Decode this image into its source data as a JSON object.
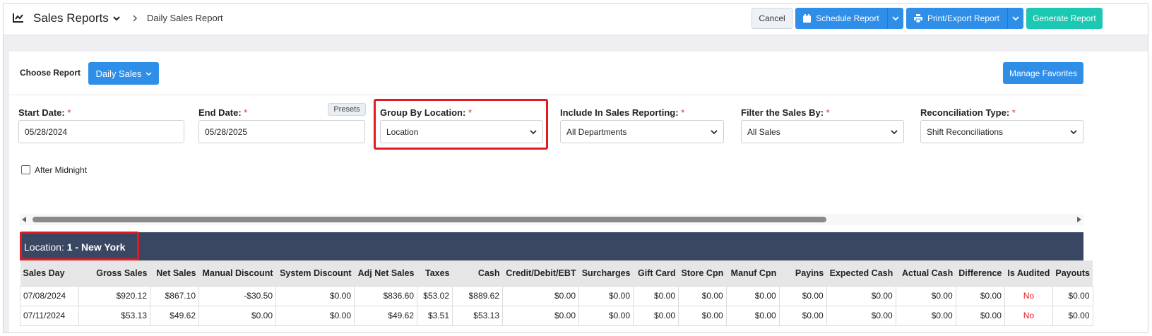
{
  "header": {
    "app_title": "Sales Reports",
    "breadcrumb": "Daily Sales Report",
    "buttons": {
      "cancel": "Cancel",
      "schedule": "Schedule Report",
      "print_export": "Print/Export Report",
      "generate": "Generate Report"
    }
  },
  "report": {
    "choose_label": "Choose Report",
    "selected": "Daily Sales",
    "manage_favorites": "Manage Favorites"
  },
  "filters": {
    "start_date": {
      "label": "Start Date:",
      "value": "05/28/2024"
    },
    "end_date": {
      "label": "End Date:",
      "value": "05/28/2025",
      "presets": "Presets"
    },
    "group_by": {
      "label": "Group By Location:",
      "value": "Location"
    },
    "include": {
      "label": "Include In Sales Reporting:",
      "value": "All Departments"
    },
    "filter_by": {
      "label": "Filter the Sales By:",
      "value": "All Sales"
    },
    "reconciliation": {
      "label": "Reconciliation Type:",
      "value": "Shift Reconciliations"
    },
    "required_mark": "*",
    "after_midnight": "After Midnight"
  },
  "location": {
    "prefix": "Location:",
    "name": "1 - New York"
  },
  "table": {
    "columns": [
      "Sales Day",
      "Gross Sales",
      "Net Sales",
      "Manual Discount",
      "System Discount",
      "Adj Net Sales",
      "Taxes",
      "Cash",
      "Credit/Debit/EBT",
      "Surcharges",
      "Gift Card",
      "Store Cpn",
      "Manuf Cpn",
      "Payins",
      "Expected Cash",
      "Actual Cash",
      "Difference",
      "Is Audited",
      "Payouts"
    ],
    "rows": [
      [
        "07/08/2024",
        "$920.12",
        "$867.10",
        "-$30.50",
        "$0.00",
        "$836.60",
        "$53.02",
        "$889.62",
        "$0.00",
        "$0.00",
        "$0.00",
        "$0.00",
        "$0.00",
        "$0.00",
        "$0.00",
        "$0.00",
        "$0.00",
        "No",
        "$0.00"
      ],
      [
        "07/11/2024",
        "$53.13",
        "$49.62",
        "$0.00",
        "$0.00",
        "$49.62",
        "$3.51",
        "$53.13",
        "$0.00",
        "$0.00",
        "$0.00",
        "$0.00",
        "$0.00",
        "$0.00",
        "$0.00",
        "$0.00",
        "$0.00",
        "No",
        "$0.00"
      ]
    ]
  },
  "colors": {
    "primary": "#2f8ee8",
    "success": "#1dc8b2",
    "location_bar": "#3a4763",
    "highlight": "#e11b22"
  }
}
